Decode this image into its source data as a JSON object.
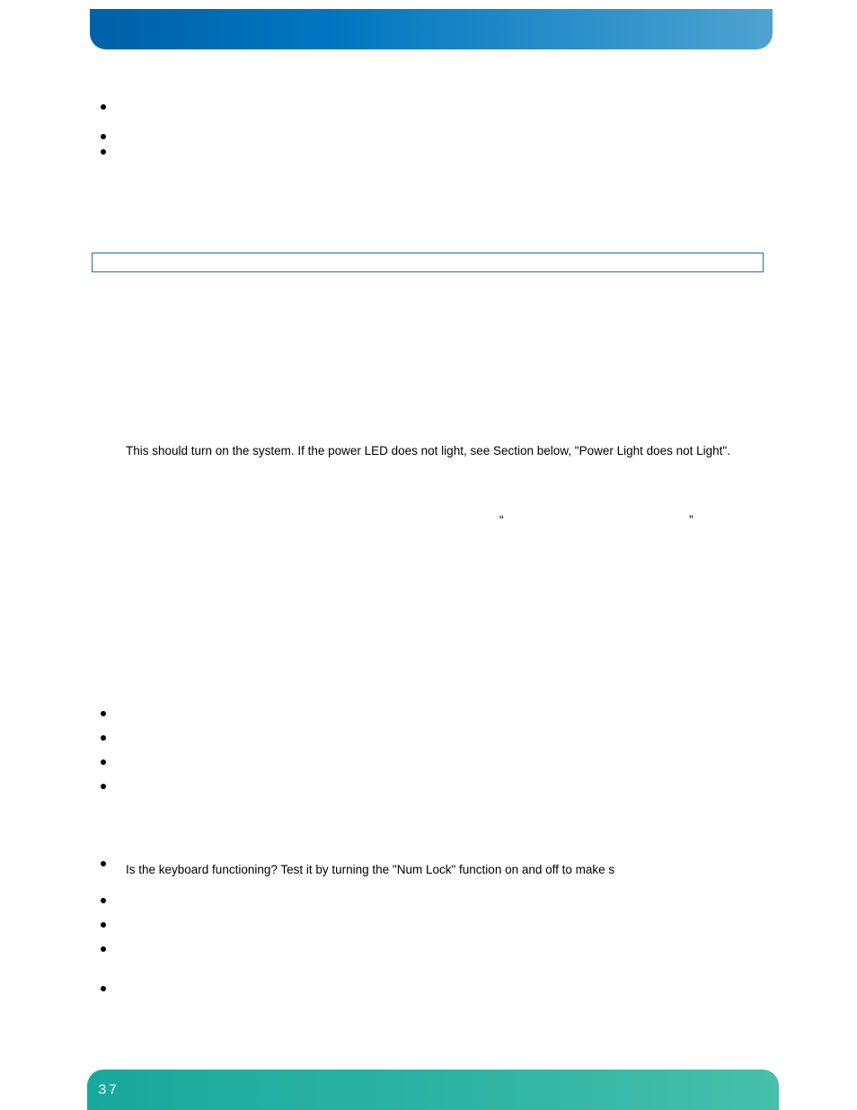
{
  "header": {
    "title": ""
  },
  "body": {
    "line1": "This should turn on the system. If the power LED does not light, see Section below, \"Power Light does not Light\".",
    "quote_open": "“",
    "quote_close": "”",
    "line2": "Is the keyboard functioning? Test it by turning the \"Num Lock\" function on and off to make s"
  },
  "footer": {
    "page_number": "37"
  }
}
